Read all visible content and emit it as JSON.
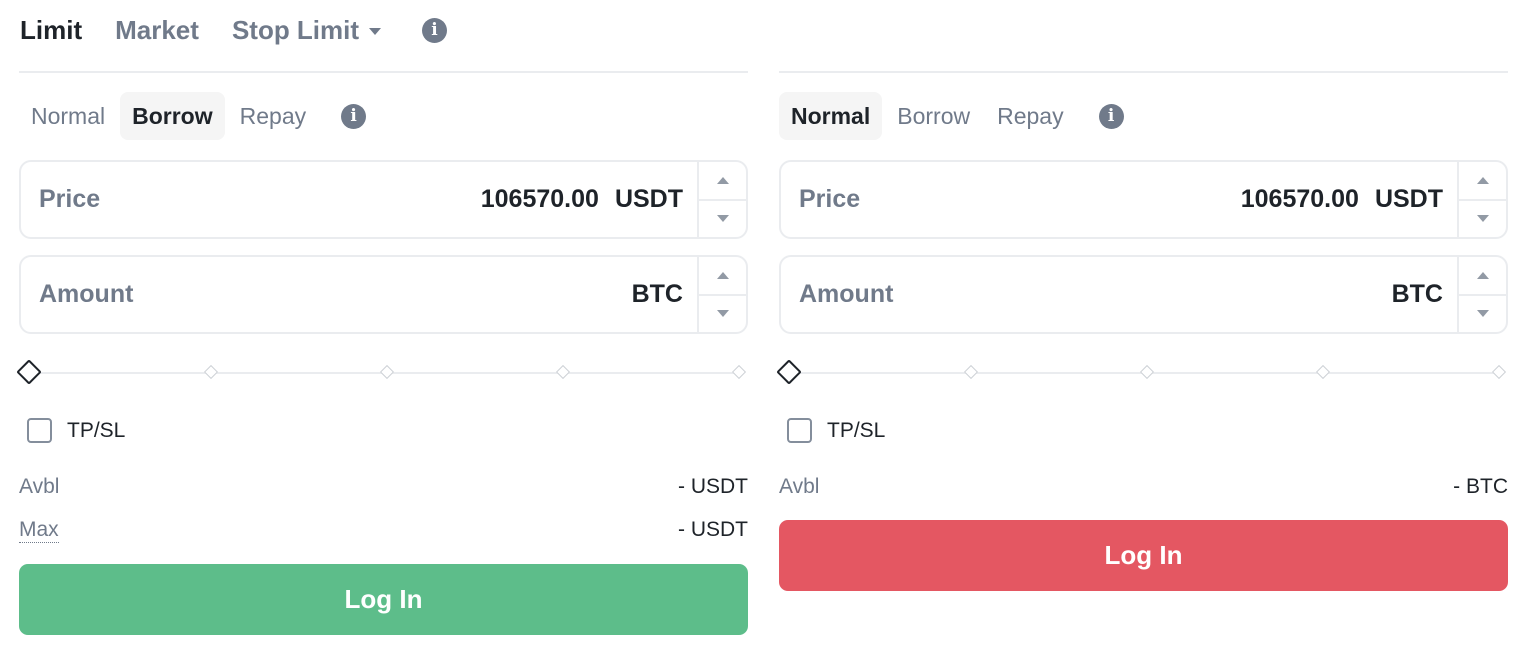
{
  "order_types": [
    {
      "label": "Limit",
      "active": true
    },
    {
      "label": "Market",
      "active": false
    },
    {
      "label": "Stop Limit",
      "active": false
    }
  ],
  "buy_panel": {
    "mode_tabs": [
      "Normal",
      "Borrow",
      "Repay"
    ],
    "active_mode": "Borrow",
    "price": {
      "label": "Price",
      "value": "106570.00",
      "unit": "USDT"
    },
    "amount": {
      "label": "Amount",
      "value": "",
      "unit": "BTC"
    },
    "slider_percent": 0,
    "tpsl_label": "TP/SL",
    "avbl": {
      "label": "Avbl",
      "value": "- USDT"
    },
    "max": {
      "label": "Max",
      "value": "- USDT"
    },
    "button_label": "Log In",
    "button_color": "#5dbd8a"
  },
  "sell_panel": {
    "mode_tabs": [
      "Normal",
      "Borrow",
      "Repay"
    ],
    "active_mode": "Normal",
    "price": {
      "label": "Price",
      "value": "106570.00",
      "unit": "USDT"
    },
    "amount": {
      "label": "Amount",
      "value": "",
      "unit": "BTC"
    },
    "slider_percent": 0,
    "tpsl_label": "TP/SL",
    "avbl": {
      "label": "Avbl",
      "value": "- BTC"
    },
    "button_label": "Log In",
    "button_color": "#e45762"
  },
  "icons": {
    "info": "info-icon",
    "dropdown": "caret-down-icon",
    "stepper_up": "caret-up-icon",
    "stepper_down": "caret-down-icon"
  }
}
